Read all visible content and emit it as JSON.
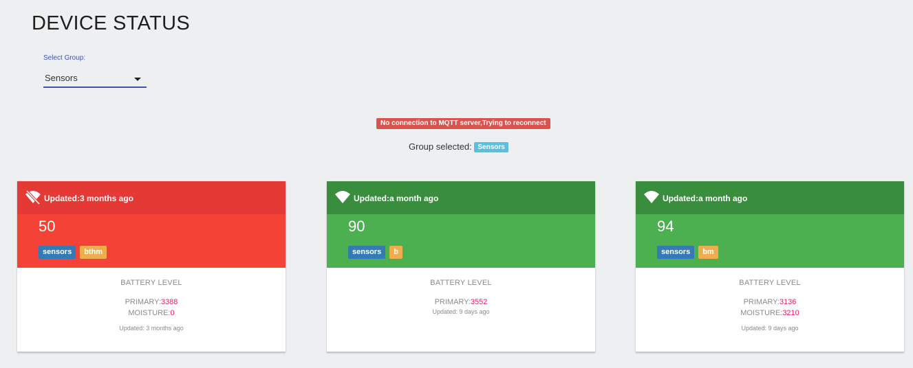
{
  "page_title": "DEVICE STATUS",
  "group_select": {
    "label": "Select Group:",
    "value": "Sensors"
  },
  "alert": "No connection to MQTT server,Trying to reconnect",
  "group_selected": {
    "prefix": "Group selected: ",
    "badge": "Sensors"
  },
  "colors": {
    "offline_header": "#e53935",
    "offline_body": "#f44336",
    "online_header": "#388e3c",
    "online_body": "#4caf50",
    "accent": "#3f51b5",
    "reading_value": "#e91e63"
  },
  "cards": [
    {
      "status": "offline",
      "icon": "wifi-off-icon",
      "updated": "Updated:3 months ago",
      "value": "50",
      "tags": [
        "sensors",
        "bthm"
      ],
      "battery_title": "BATTERY LEVEL",
      "primary_label": "PRIMARY:",
      "primary_value": "3388",
      "moisture_label": "MOISTURE:",
      "moisture_value": "0",
      "footer_updated": "Updated: 3 months ago"
    },
    {
      "status": "online",
      "icon": "wifi-icon",
      "updated": "Updated:a month ago",
      "value": "90",
      "tags": [
        "sensors",
        "b"
      ],
      "battery_title": "BATTERY LEVEL",
      "primary_label": "PRIMARY:",
      "primary_value": "3552",
      "footer_updated": "Updated: 9 days ago"
    },
    {
      "status": "online",
      "icon": "wifi-icon",
      "updated": "Updated:a month ago",
      "value": "94",
      "tags": [
        "sensors",
        "bm"
      ],
      "battery_title": "BATTERY LEVEL",
      "primary_label": "PRIMARY:",
      "primary_value": "3136",
      "moisture_label": "MOISTURE:",
      "moisture_value": "3210",
      "footer_updated": "Updated: 9 days ago"
    }
  ]
}
